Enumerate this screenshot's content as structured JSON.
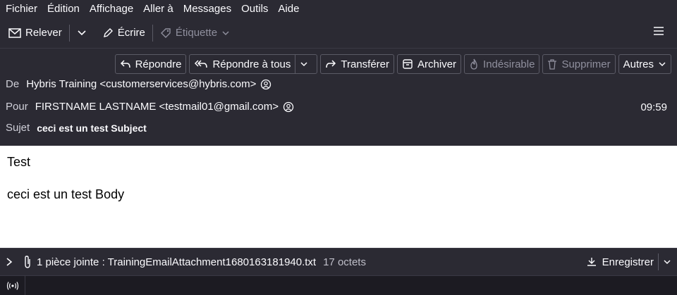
{
  "menu": {
    "items": [
      "Fichier",
      "Édition",
      "Affichage",
      "Aller à",
      "Messages",
      "Outils",
      "Aide"
    ]
  },
  "toolbar": {
    "get_mail": "Relever",
    "write": "Écrire",
    "tag": "Étiquette"
  },
  "actions": {
    "reply": "Répondre",
    "reply_all": "Répondre à tous",
    "forward": "Transférer",
    "archive": "Archiver",
    "junk": "Indésirable",
    "delete": "Supprimer",
    "more": "Autres"
  },
  "header": {
    "from_label": "De",
    "from_value": "Hybris Training <customerservices@hybris.com>",
    "to_label": "Pour",
    "to_value": "FIRSTNAME LASTNAME <testmail01@gmail.com>",
    "time": "09:59",
    "subject_label": "Sujet",
    "subject_value": "ceci est un test Subject"
  },
  "message": {
    "line1": "Test",
    "line2": "ceci est un test Body"
  },
  "attachment": {
    "summary": "1 pièce jointe : TrainingEmailAttachment1680163181940.txt",
    "size": "17 octets",
    "save": "Enregistrer"
  },
  "colors": {
    "accent_bg": "#2b2a33",
    "body_bg": "#ffffff"
  }
}
